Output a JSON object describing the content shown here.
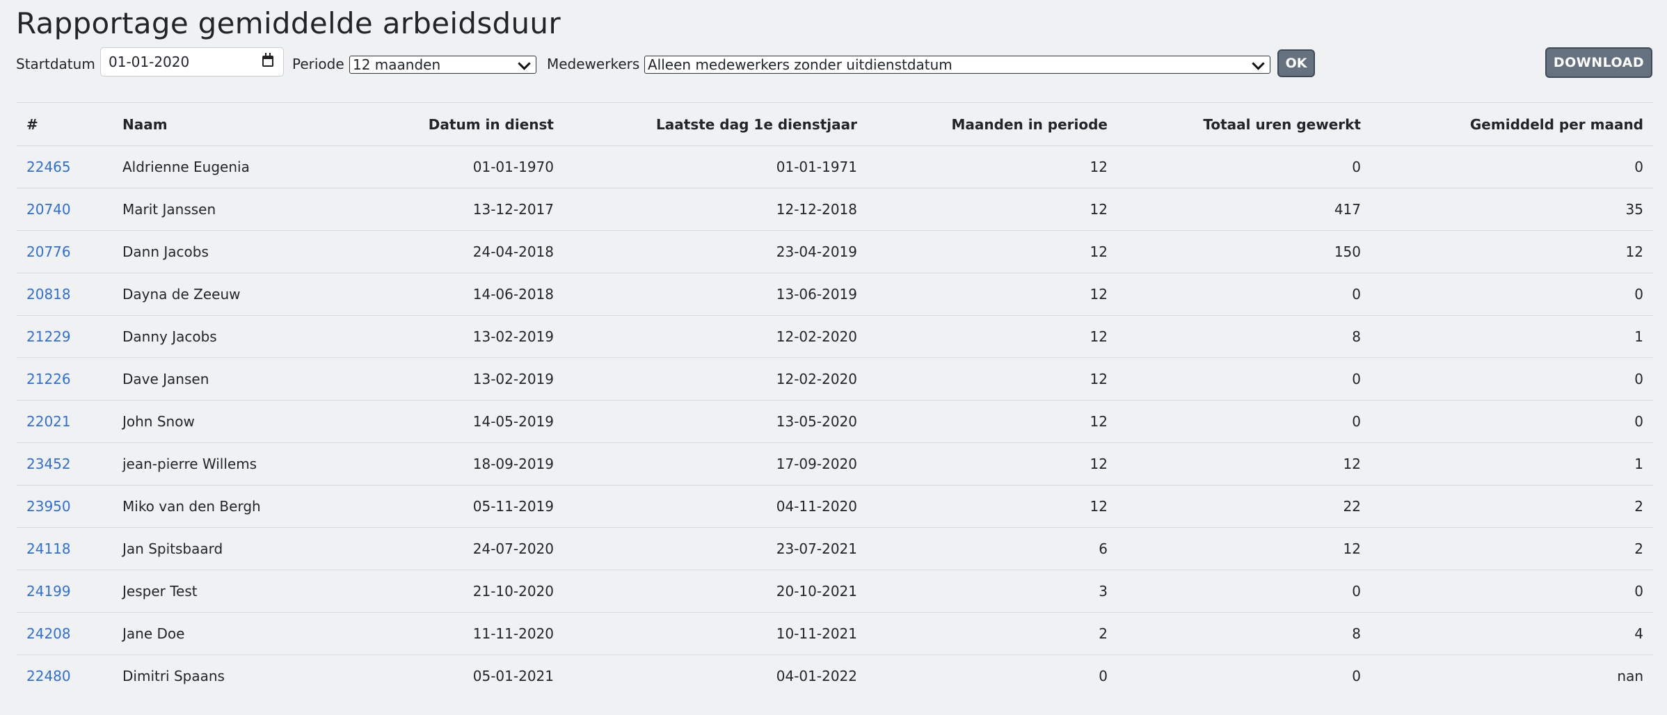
{
  "page": {
    "title": "Rapportage gemiddelde arbeidsduur"
  },
  "filters": {
    "start_label": "Startdatum",
    "start_value": "01-01-2020",
    "periode_label": "Periode",
    "periode_value": "12 maanden",
    "medewerkers_label": "Medewerkers",
    "medewerkers_value": "Alleen medewerkers zonder uitdienstdatum",
    "ok_label": "OK",
    "download_label": "DOWNLOAD"
  },
  "table": {
    "headers": [
      "#",
      "Naam",
      "Datum in dienst",
      "Laatste dag 1e dienstjaar",
      "Maanden in periode",
      "Totaal uren gewerkt",
      "Gemiddeld per maand"
    ],
    "rows": [
      {
        "id": "22465",
        "naam": "Aldrienne Eugenia",
        "in_dienst": "01-01-1970",
        "laatste_dag": "01-01-1971",
        "maanden": "12",
        "totaal": "0",
        "gemiddeld": "0"
      },
      {
        "id": "20740",
        "naam": "Marit Janssen",
        "in_dienst": "13-12-2017",
        "laatste_dag": "12-12-2018",
        "maanden": "12",
        "totaal": "417",
        "gemiddeld": "35"
      },
      {
        "id": "20776",
        "naam": "Dann Jacobs",
        "in_dienst": "24-04-2018",
        "laatste_dag": "23-04-2019",
        "maanden": "12",
        "totaal": "150",
        "gemiddeld": "12"
      },
      {
        "id": "20818",
        "naam": "Dayna de Zeeuw",
        "in_dienst": "14-06-2018",
        "laatste_dag": "13-06-2019",
        "maanden": "12",
        "totaal": "0",
        "gemiddeld": "0"
      },
      {
        "id": "21229",
        "naam": "Danny Jacobs",
        "in_dienst": "13-02-2019",
        "laatste_dag": "12-02-2020",
        "maanden": "12",
        "totaal": "8",
        "gemiddeld": "1"
      },
      {
        "id": "21226",
        "naam": "Dave Jansen",
        "in_dienst": "13-02-2019",
        "laatste_dag": "12-02-2020",
        "maanden": "12",
        "totaal": "0",
        "gemiddeld": "0"
      },
      {
        "id": "22021",
        "naam": "John Snow",
        "in_dienst": "14-05-2019",
        "laatste_dag": "13-05-2020",
        "maanden": "12",
        "totaal": "0",
        "gemiddeld": "0"
      },
      {
        "id": "23452",
        "naam": "jean-pierre Willems",
        "in_dienst": "18-09-2019",
        "laatste_dag": "17-09-2020",
        "maanden": "12",
        "totaal": "12",
        "gemiddeld": "1"
      },
      {
        "id": "23950",
        "naam": "Miko van den Bergh",
        "in_dienst": "05-11-2019",
        "laatste_dag": "04-11-2020",
        "maanden": "12",
        "totaal": "22",
        "gemiddeld": "2"
      },
      {
        "id": "24118",
        "naam": "Jan Spitsbaard",
        "in_dienst": "24-07-2020",
        "laatste_dag": "23-07-2021",
        "maanden": "6",
        "totaal": "12",
        "gemiddeld": "2"
      },
      {
        "id": "24199",
        "naam": "Jesper Test",
        "in_dienst": "21-10-2020",
        "laatste_dag": "20-10-2021",
        "maanden": "3",
        "totaal": "0",
        "gemiddeld": "0"
      },
      {
        "id": "24208",
        "naam": "Jane Doe",
        "in_dienst": "11-11-2020",
        "laatste_dag": "10-11-2021",
        "maanden": "2",
        "totaal": "8",
        "gemiddeld": "4"
      },
      {
        "id": "22480",
        "naam": "Dimitri Spaans",
        "in_dienst": "05-01-2021",
        "laatste_dag": "04-01-2022",
        "maanden": "0",
        "totaal": "0",
        "gemiddeld": "nan"
      }
    ]
  }
}
